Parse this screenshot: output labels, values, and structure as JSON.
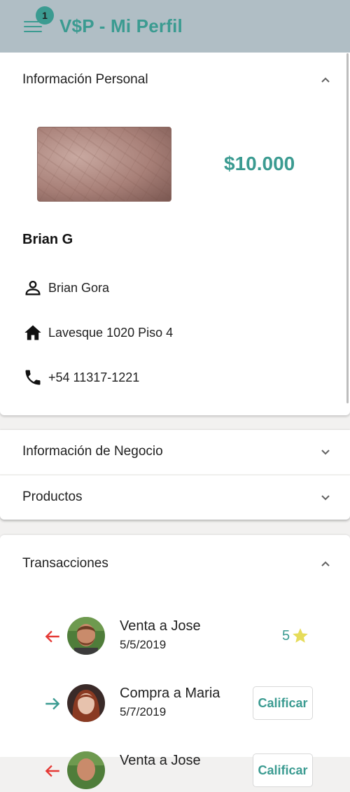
{
  "app": {
    "title": "V$P - Mi Perfil",
    "notification_count": "1",
    "accent_color": "#3b9b91",
    "toolbar_color": "#b0bec5"
  },
  "personal": {
    "header": "Información Personal",
    "balance": "$10.000",
    "display_name": "Brian G",
    "full_name": "Brian Gora",
    "address": "Lavesque 1020 Piso 4",
    "phone": "+54 11317-1221",
    "icons": [
      "person-icon",
      "home-icon",
      "phone-icon"
    ]
  },
  "business": {
    "header": "Información de Negocio"
  },
  "products": {
    "header": "Productos"
  },
  "transactions": {
    "header": "Transacciones",
    "items": [
      {
        "title": "Venta a Jose",
        "date": "5/5/2019",
        "direction": "outgoing",
        "arrow_color": "#e53935",
        "rating": "5"
      },
      {
        "title": "Compra a Maria",
        "date": "5/7/2019",
        "direction": "incoming",
        "arrow_color": "#3b9b91",
        "action_label": "Calificar"
      },
      {
        "title": "Venta a Jose",
        "date": "",
        "direction": "outgoing",
        "arrow_color": "#e53935",
        "action_label": "Calificar"
      }
    ]
  }
}
